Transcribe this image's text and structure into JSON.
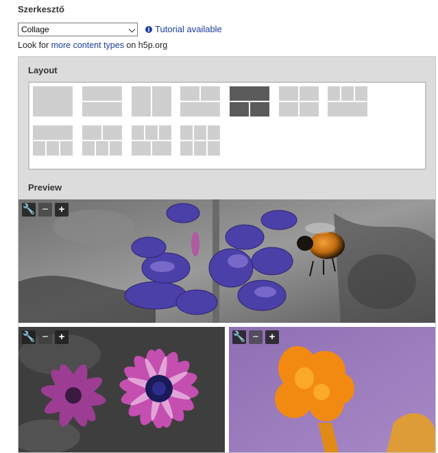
{
  "editor": {
    "title": "Szerkesztő",
    "content_type": "Collage",
    "tutorial_label": "Tutorial available",
    "lookfor_prefix": "Look for ",
    "lookfor_link": "more content types",
    "lookfor_suffix": " on h5p.org"
  },
  "layout": {
    "label": "Layout",
    "selected_index": 4,
    "option_count": 11
  },
  "preview": {
    "label": "Preview"
  },
  "tile_controls": {
    "edit_icon": "wrench-icon",
    "zoom_out": "−",
    "zoom_in": "+"
  }
}
